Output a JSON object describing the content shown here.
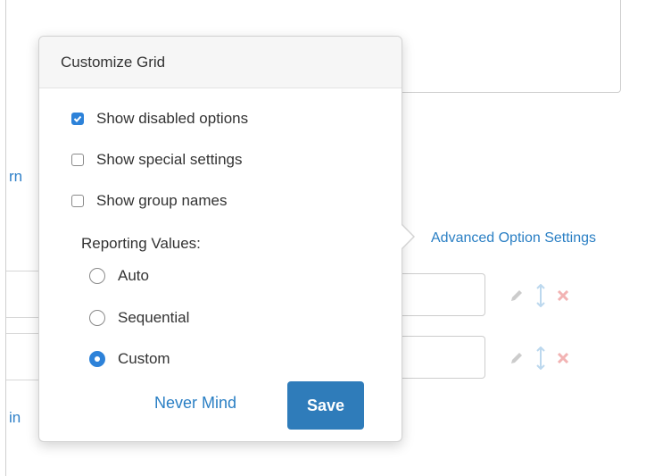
{
  "background": {
    "partial_link_learn": "rn",
    "partial_link_in": "in",
    "advanced_link": "Advanced Option Settings"
  },
  "popover": {
    "title": "Customize Grid",
    "checkboxes": [
      {
        "label": "Show disabled options",
        "checked": true
      },
      {
        "label": "Show special settings",
        "checked": false
      },
      {
        "label": "Show group names",
        "checked": false
      }
    ],
    "reporting_label": "Reporting Values:",
    "radios": [
      {
        "label": "Auto",
        "checked": false
      },
      {
        "label": "Sequential",
        "checked": false
      },
      {
        "label": "Custom",
        "checked": true
      }
    ],
    "cancel_label": "Never Mind",
    "save_label": "Save"
  },
  "icons": [
    "pencil-icon",
    "resize-vertical-icon",
    "delete-icon"
  ],
  "colors": {
    "accent": "#2d82d9",
    "link": "#2a7fc4",
    "save_button": "#2f7cba",
    "delete_icon": "#f2b3b3",
    "edit_icon": "#cccccc",
    "move_icon": "#bcd8ee"
  }
}
